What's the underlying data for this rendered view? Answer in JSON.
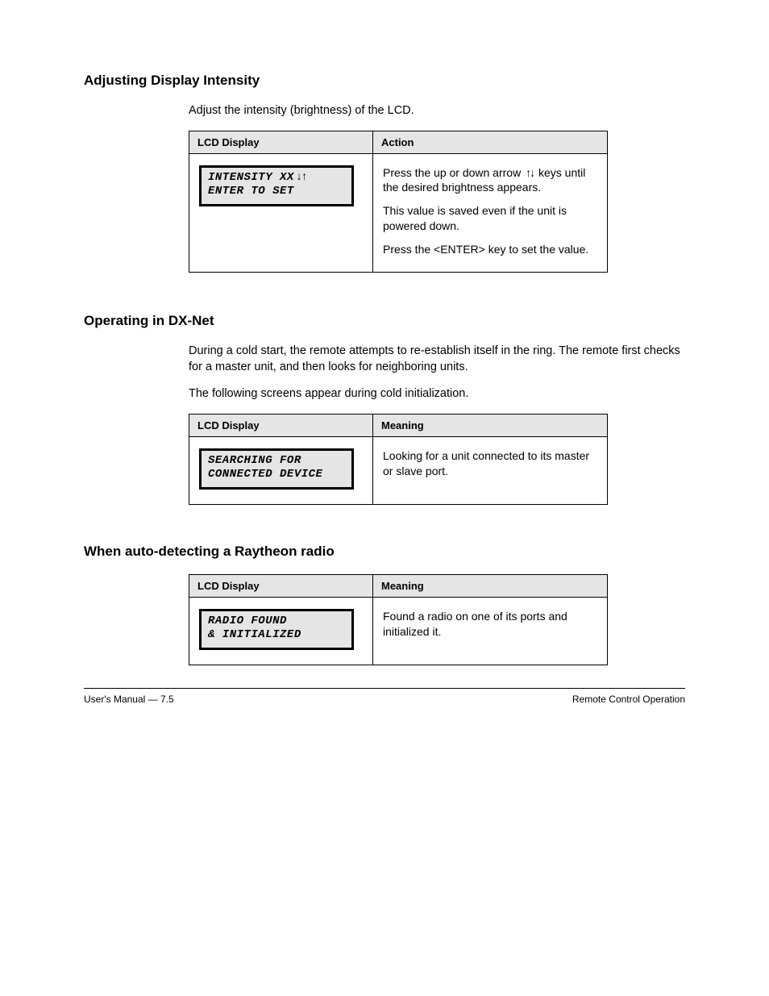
{
  "sections": [
    {
      "title": "Adjusting Display Intensity",
      "lead": "Adjust the intensity (brightness) of the LCD.",
      "table": {
        "headers": [
          "LCD Display",
          "Action"
        ],
        "display": {
          "line1_pre": "INTENSITY  XX",
          "line1_post": "",
          "line2": "ENTER TO SET"
        },
        "action_parts": {
          "p1_a": "Press the up or down arrow ",
          "p1_b": " keys until the desired brightness appears.",
          "p2": "This value is saved even if the unit is powered down.",
          "p3_a": "Press the ",
          "p3_key": "<ENTER>",
          "p3_b": " key to set the value."
        }
      }
    },
    {
      "title": "Operating in DX-Net",
      "para1": "During a cold start, the remote attempts to re-establish itself in the ring.  The remote first checks for a master unit, and then looks for neighboring units.",
      "para2": "The following screens appear during cold initialization.",
      "table": {
        "headers": [
          "LCD Display",
          "Meaning"
        ],
        "display": {
          "line1": "SEARCHING FOR",
          "line2": "CONNECTED DEVICE"
        },
        "action": "Looking for a unit connected to its master or slave port."
      }
    },
    {
      "title": "When auto-detecting a Raytheon radio",
      "table": {
        "headers": [
          "LCD Display",
          "Meaning"
        ],
        "display": {
          "line1": "RADIO FOUND",
          "line2": "& INITIALIZED"
        },
        "action": "Found a radio on one of its ports and initialized it."
      }
    }
  ],
  "arrows_up_down": "↑↓",
  "arrows_down_up": "↓↑",
  "footer": {
    "left": "User's Manual — 7.5",
    "right": "Remote Control Operation"
  }
}
